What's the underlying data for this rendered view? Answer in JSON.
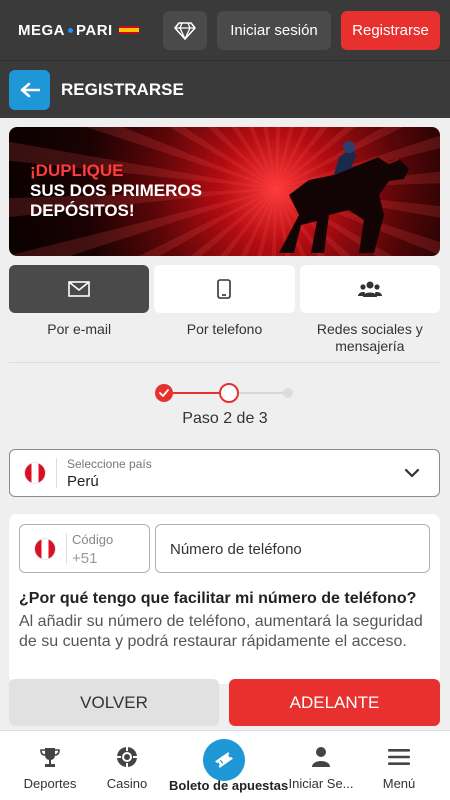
{
  "header": {
    "logo_left": "MEGA",
    "logo_right": "PARI",
    "login_label": "Iniciar sesión",
    "register_label": "Registrarse"
  },
  "page": {
    "title": "REGISTRARSE"
  },
  "banner": {
    "highlight": "¡DUPLIQUE",
    "line2": "SUS DOS PRIMEROS",
    "line3": "DEPÓSITOS!"
  },
  "methods": [
    {
      "label": "Por e-mail",
      "icon": "email-icon",
      "active": true
    },
    {
      "label": "Por telefono",
      "icon": "phone-icon",
      "active": false
    },
    {
      "label": "Redes sociales y mensajería",
      "icon": "users-icon",
      "active": false
    }
  ],
  "stepper": {
    "current": 2,
    "total": 3,
    "text": "Paso 2 de 3"
  },
  "country": {
    "label": "Seleccione país",
    "value": "Perú"
  },
  "phone": {
    "code_label": "Código",
    "code_value": "+51",
    "placeholder": "Número de teléfono"
  },
  "info": {
    "title": "¿Por qué tengo que facilitar mi número de teléfono?",
    "text": "Al añadir su número de teléfono, aumentará la seguridad de su cuenta y podrá restaurar rápidamente el acceso."
  },
  "actions": {
    "back_label": "VOLVER",
    "next_label": "ADELANTE"
  },
  "bottom_nav": {
    "sports": "Deportes",
    "casino": "Casino",
    "betslip": "Boleto de apuestas",
    "login": "Iniciar Se...",
    "menu": "Menú"
  },
  "colors": {
    "accent_red": "#e8312f",
    "accent_blue": "#1f96d6",
    "header_bg": "#3a3a3a"
  }
}
